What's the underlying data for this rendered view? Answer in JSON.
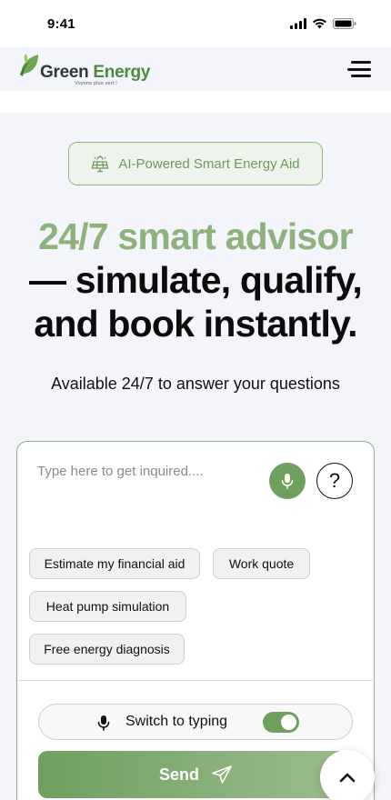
{
  "status_bar": {
    "time": "9:41"
  },
  "header": {
    "logo_brand_part1": "Green",
    "logo_brand_part2": " Energy",
    "logo_tagline": "Voyons plus vert !"
  },
  "badge": {
    "label": "AI-Powered Smart Energy Aid",
    "icon": "solar-panel-icon"
  },
  "hero": {
    "line1": "24/7 smart advisor",
    "line2": "— simulate, qualify,",
    "line3": "and book instantly."
  },
  "subtitle": "Available 24/7 to answer your questions",
  "chat": {
    "placeholder": "Type here to get inquired....",
    "help_symbol": "?",
    "chips": [
      {
        "label": "Estimate my financial aid"
      },
      {
        "label": "Work quote"
      },
      {
        "label": "Heat pump simulation"
      },
      {
        "label": "Free energy diagnosis"
      }
    ],
    "switch_label": "Switch to typing",
    "toggle_on": true,
    "send_label": "Send"
  },
  "colors": {
    "accent_green": "#8db27c",
    "button_green": "#6f9f5f",
    "background": "#f3f5fb"
  }
}
